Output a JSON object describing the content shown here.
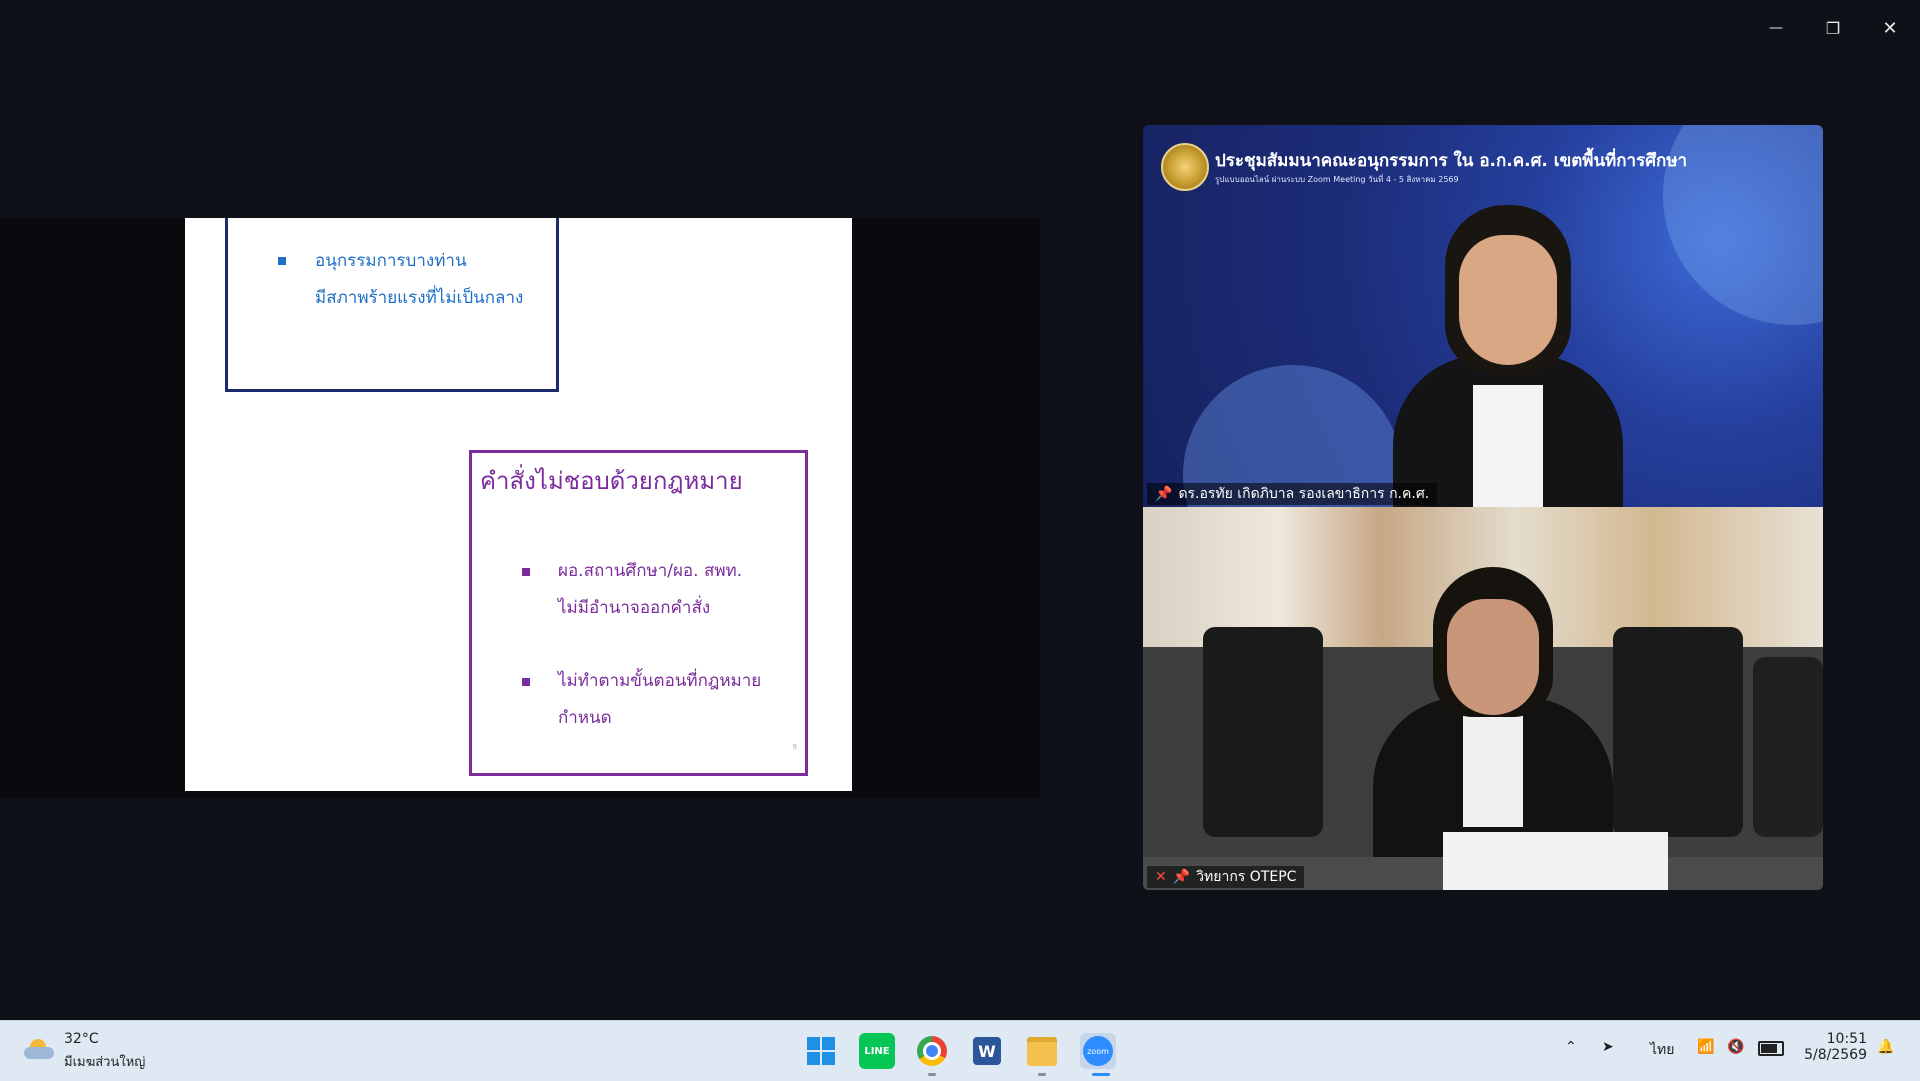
{
  "window_controls": {
    "minimize": "—",
    "restore": "❐",
    "close": "✕"
  },
  "slide": {
    "top_box": {
      "bullet_line1": "อนุกรรมการบางท่าน",
      "bullet_line2": "มีสภาพร้ายแรงที่ไม่เป็นกลาง"
    },
    "bottom_box": {
      "heading": "คำสั่งไม่ชอบด้วยกฎหมาย",
      "b1_line1": "ผอ.สถานศึกษา/ผอ. สพท.",
      "b1_line2": "ไม่มีอำนาจออกคำสั่ง",
      "b2_line1": "ไม่ทำตามขั้นตอนที่กฎหมาย",
      "b2_line2": "กำหนด"
    },
    "page_number": "9"
  },
  "video_panels": [
    {
      "banner_title": "ประชุมสัมมนาคณะอนุกรรมการ ใน อ.ก.ค.ศ. เขตพื้นที่การศึกษา",
      "banner_subtitle": "รูปแบบออนไลน์ ผ่านระบบ Zoom Meeting วันที่ 4 - 5 สิงหาคม 2569",
      "participant_name": "ดร.อรทัย เกิดภิบาล รองเลขาธิการ ก.ค.ศ."
    },
    {
      "participant_name": "วิทยากร OTEPC"
    }
  ],
  "taskbar": {
    "weather_temp": "32°C",
    "weather_desc": "มีเมฆส่วนใหญ่",
    "language": "ไทย",
    "time": "10:51",
    "date": "5/8/2569",
    "apps": [
      "windows-start",
      "line",
      "chrome",
      "word",
      "file-explorer",
      "zoom"
    ]
  },
  "colors": {
    "slide_blue": "#1f6fc6",
    "slide_purple": "#7b2c9c",
    "box_navy": "#1a2a6c",
    "zoom_blue": "#2d8cff"
  }
}
